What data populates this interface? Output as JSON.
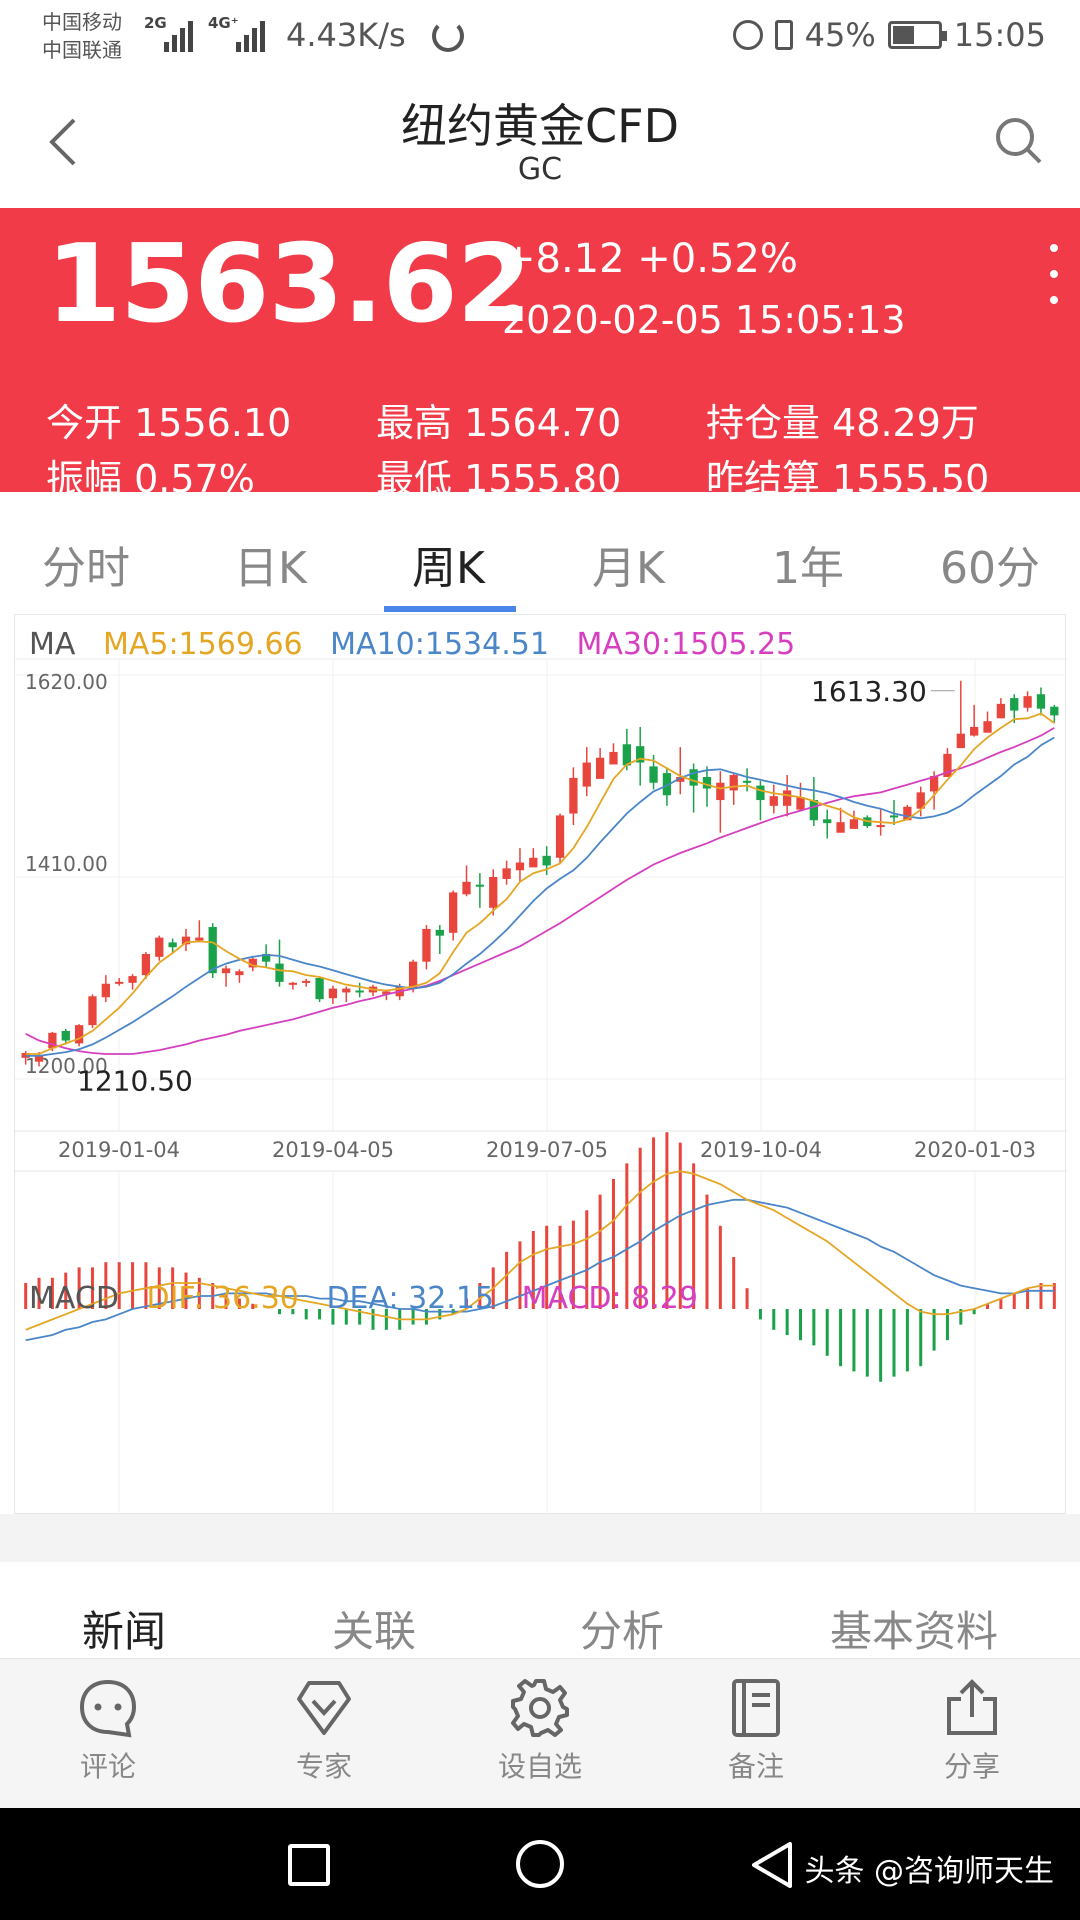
{
  "status_bar": {
    "carrier_1": "中国移动",
    "carrier_2": "中国联通",
    "network_1": "2G",
    "network_2": "4G⁺",
    "speed": "4.43K/s",
    "battery": "45%",
    "time": "15:05"
  },
  "header": {
    "title": "纽约黄金CFD",
    "subtitle": "GC"
  },
  "quote": {
    "price": "1563.62",
    "change": "+8.12 +0.52%",
    "timestamp": "2020-02-05 15:05:13",
    "stats": [
      {
        "label": "今开",
        "value": "1556.10"
      },
      {
        "label": "最高",
        "value": "1564.70"
      },
      {
        "label": "持仓量",
        "value": "48.29万"
      },
      {
        "label": "振幅",
        "value": "0.57%"
      },
      {
        "label": "最低",
        "value": "1555.80"
      },
      {
        "label": "昨结算",
        "value": "1555.50"
      }
    ]
  },
  "period_tabs": [
    {
      "label": "分时",
      "active": false
    },
    {
      "label": "日K",
      "active": false
    },
    {
      "label": "周K",
      "active": true
    },
    {
      "label": "月K",
      "active": false
    },
    {
      "label": "1年",
      "active": false
    },
    {
      "label": "60分",
      "active": false
    }
  ],
  "indicators": {
    "ma_label": "MA",
    "ma5": "MA5:1569.66",
    "ma10": "MA10:1534.51",
    "ma30": "MA30:1505.25",
    "macd_label": "MACD",
    "dif": "DIF: 36.30",
    "dea": "DEA: 32.15",
    "macd": "MACD: 8.29"
  },
  "colors": {
    "up": "#e8453c",
    "down": "#1aa24a",
    "ma5": "#e5a623",
    "ma10": "#4a86c8",
    "ma30": "#d63fbf",
    "accent": "#f23b48"
  },
  "chart_data": {
    "type": "candlestick",
    "y_tick_labels": [
      "1620.00",
      "1410.00",
      "1200.00"
    ],
    "ylim": [
      1200,
      1620
    ],
    "x_tick_labels": [
      "2019-01-04",
      "2019-04-05",
      "2019-07-05",
      "2019-10-04",
      "2020-01-03"
    ],
    "high_label": "1613.30",
    "low_label": "1210.50",
    "candles": [
      [
        1222,
        1227,
        1215,
        1229
      ],
      [
        1218,
        1225,
        1213,
        1228
      ],
      [
        1232,
        1248,
        1229,
        1249
      ],
      [
        1250,
        1240,
        1236,
        1252
      ],
      [
        1237,
        1256,
        1234,
        1257
      ],
      [
        1256,
        1286,
        1253,
        1288
      ],
      [
        1285,
        1299,
        1280,
        1308
      ],
      [
        1300,
        1301,
        1297,
        1305
      ],
      [
        1300,
        1307,
        1293,
        1309
      ],
      [
        1308,
        1330,
        1304,
        1332
      ],
      [
        1327,
        1347,
        1323,
        1349
      ],
      [
        1342,
        1337,
        1330,
        1346
      ],
      [
        1340,
        1348,
        1333,
        1356
      ],
      [
        1344,
        1347,
        1342,
        1365
      ],
      [
        1358,
        1310,
        1305,
        1362
      ],
      [
        1310,
        1315,
        1296,
        1318
      ],
      [
        1308,
        1312,
        1300,
        1314
      ],
      [
        1316,
        1325,
        1312,
        1327
      ],
      [
        1330,
        1322,
        1316,
        1340
      ],
      [
        1320,
        1301,
        1296,
        1345
      ],
      [
        1300,
        1300,
        1293,
        1301
      ],
      [
        1302,
        1302,
        1296,
        1304
      ],
      [
        1305,
        1283,
        1280,
        1306
      ],
      [
        1284,
        1294,
        1278,
        1297
      ],
      [
        1290,
        1294,
        1280,
        1296
      ],
      [
        1292,
        1290,
        1285,
        1300
      ],
      [
        1290,
        1296,
        1286,
        1298
      ],
      [
        1288,
        1291,
        1282,
        1293
      ],
      [
        1286,
        1296,
        1282,
        1299
      ],
      [
        1294,
        1322,
        1290,
        1324
      ],
      [
        1322,
        1356,
        1314,
        1360
      ],
      [
        1355,
        1349,
        1330,
        1360
      ],
      [
        1352,
        1394,
        1344,
        1396
      ],
      [
        1392,
        1405,
        1390,
        1422
      ],
      [
        1402,
        1400,
        1378,
        1414
      ],
      [
        1378,
        1410,
        1370,
        1418
      ],
      [
        1408,
        1419,
        1402,
        1427
      ],
      [
        1417,
        1425,
        1405,
        1440
      ],
      [
        1420,
        1430,
        1424,
        1440
      ],
      [
        1432,
        1422,
        1412,
        1442
      ],
      [
        1430,
        1474,
        1424,
        1476
      ],
      [
        1476,
        1513,
        1464,
        1524
      ],
      [
        1504,
        1529,
        1494,
        1545
      ],
      [
        1512,
        1534,
        1517,
        1544
      ],
      [
        1527,
        1540,
        1532,
        1549
      ],
      [
        1548,
        1526,
        1521,
        1564
      ],
      [
        1546,
        1529,
        1505,
        1566
      ],
      [
        1525,
        1508,
        1501,
        1537
      ],
      [
        1518,
        1495,
        1484,
        1523
      ],
      [
        1509,
        1514,
        1496,
        1545
      ],
      [
        1522,
        1505,
        1477,
        1528
      ],
      [
        1514,
        1502,
        1483,
        1525
      ],
      [
        1490,
        1508,
        1456,
        1520
      ],
      [
        1500,
        1516,
        1485,
        1517
      ],
      [
        1510,
        1508,
        1499,
        1523
      ],
      [
        1505,
        1490,
        1469,
        1510
      ],
      [
        1484,
        1494,
        1476,
        1506
      ],
      [
        1484,
        1500,
        1473,
        1516
      ],
      [
        1480,
        1493,
        1478,
        1508
      ],
      [
        1490,
        1469,
        1463,
        1514
      ],
      [
        1470,
        1466,
        1450,
        1480
      ],
      [
        1456,
        1467,
        1460,
        1482
      ],
      [
        1460,
        1470,
        1466,
        1479
      ],
      [
        1472,
        1463,
        1461,
        1474
      ],
      [
        1462,
        1464,
        1453,
        1480
      ],
      [
        1474,
        1472,
        1464,
        1490
      ],
      [
        1469,
        1483,
        1470,
        1485
      ],
      [
        1481,
        1498,
        1473,
        1504
      ],
      [
        1499,
        1515,
        1480,
        1520
      ],
      [
        1514,
        1538,
        1515,
        1544
      ],
      [
        1544,
        1559,
        1547,
        1614
      ],
      [
        1557,
        1566,
        1556,
        1589
      ],
      [
        1560,
        1572,
        1568,
        1582
      ],
      [
        1575,
        1590,
        1575,
        1596
      ],
      [
        1596,
        1583,
        1570,
        1600
      ],
      [
        1586,
        1598,
        1582,
        1603
      ],
      [
        1600,
        1585,
        1578,
        1607
      ],
      [
        1587,
        1578,
        1570,
        1589
      ]
    ],
    "ma5_values": [
      1226,
      1226,
      1232,
      1237,
      1242,
      1250,
      1262,
      1274,
      1289,
      1306,
      1321,
      1331,
      1342,
      1343,
      1342,
      1333,
      1325,
      1318,
      1316,
      1313,
      1312,
      1308,
      1306,
      1302,
      1298,
      1296,
      1293,
      1292,
      1294,
      1296,
      1300,
      1310,
      1332,
      1352,
      1362,
      1375,
      1387,
      1405,
      1414,
      1418,
      1424,
      1440,
      1462,
      1487,
      1512,
      1527,
      1533,
      1531,
      1523,
      1515,
      1510,
      1506,
      1502,
      1504,
      1505,
      1500,
      1497,
      1495,
      1493,
      1489,
      1484,
      1480,
      1472,
      1468,
      1467,
      1466,
      1470,
      1480,
      1495,
      1511,
      1526,
      1543,
      1555,
      1565,
      1574,
      1575,
      1580,
      1570
    ],
    "ma10_values": [
      1224,
      1224,
      1226,
      1228,
      1231,
      1236,
      1243,
      1251,
      1259,
      1268,
      1277,
      1286,
      1296,
      1305,
      1314,
      1320,
      1324,
      1327,
      1329,
      1328,
      1324,
      1320,
      1317,
      1313,
      1309,
      1305,
      1301,
      1298,
      1296,
      1294,
      1296,
      1300,
      1309,
      1320,
      1330,
      1342,
      1355,
      1370,
      1385,
      1398,
      1408,
      1417,
      1430,
      1446,
      1461,
      1476,
      1488,
      1499,
      1505,
      1513,
      1518,
      1521,
      1522,
      1518,
      1514,
      1511,
      1508,
      1505,
      1502,
      1500,
      1497,
      1493,
      1488,
      1484,
      1481,
      1476,
      1473,
      1471,
      1473,
      1477,
      1484,
      1495,
      1505,
      1515,
      1527,
      1535,
      1547,
      1555
    ],
    "ma30_values": [
      1247,
      1240,
      1236,
      1232,
      1229,
      1227,
      1226,
      1226,
      1226,
      1228,
      1230,
      1233,
      1236,
      1240,
      1243,
      1246,
      1250,
      1253,
      1256,
      1259,
      1262,
      1266,
      1270,
      1274,
      1277,
      1281,
      1284,
      1288,
      1291,
      1294,
      1297,
      1302,
      1308,
      1314,
      1320,
      1326,
      1332,
      1338,
      1346,
      1354,
      1362,
      1371,
      1380,
      1389,
      1398,
      1407,
      1415,
      1423,
      1429,
      1435,
      1440,
      1445,
      1451,
      1456,
      1461,
      1466,
      1471,
      1475,
      1479,
      1483,
      1487,
      1491,
      1494,
      1496,
      1498,
      1502,
      1506,
      1510,
      1514,
      1519,
      1523,
      1528,
      1534,
      1540,
      1545,
      1551,
      1557,
      1565
    ],
    "macd_dif": [
      -8,
      -6,
      -4,
      -2,
      0,
      2,
      4,
      6,
      7,
      8,
      9,
      10,
      10,
      10,
      9,
      8,
      7,
      6,
      5,
      5,
      4,
      3,
      2,
      1,
      0,
      -1,
      -2,
      -3,
      -4,
      -4,
      -4,
      -3,
      -2,
      0,
      4,
      8,
      13,
      18,
      21,
      23,
      24,
      25,
      27,
      30,
      34,
      40,
      45,
      49,
      52,
      53,
      52,
      50,
      48,
      45,
      42,
      40,
      38,
      35,
      32,
      29,
      26,
      22,
      18,
      14,
      10,
      6,
      2,
      -1,
      -2,
      -2,
      -1,
      0,
      2,
      4,
      6,
      8,
      9,
      9
    ],
    "macd_dea": [
      -12,
      -11,
      -10,
      -8,
      -7,
      -5,
      -4,
      -2,
      0,
      1,
      2,
      3,
      4,
      5,
      5,
      6,
      6,
      6,
      6,
      5,
      5,
      5,
      4,
      4,
      3,
      3,
      2,
      1,
      0,
      0,
      -1,
      -1,
      -1,
      -1,
      0,
      1,
      3,
      5,
      7,
      9,
      11,
      13,
      15,
      18,
      20,
      23,
      26,
      30,
      33,
      36,
      38,
      40,
      41,
      42,
      42,
      41,
      40,
      39,
      37,
      35,
      33,
      31,
      29,
      27,
      24,
      22,
      19,
      16,
      13,
      11,
      9,
      8,
      7,
      6,
      6,
      7,
      7,
      7
    ],
    "macd_bar": [
      5,
      6,
      6,
      7,
      8,
      8,
      9,
      9,
      9,
      9,
      8,
      8,
      7,
      6,
      5,
      3,
      2,
      1,
      0,
      -1,
      -1,
      -2,
      -2,
      -3,
      -3,
      -3,
      -4,
      -4,
      -4,
      -3,
      -3,
      -2,
      -1,
      2,
      5,
      8,
      11,
      13,
      15,
      16,
      16,
      17,
      19,
      22,
      25,
      28,
      31,
      33,
      34,
      32,
      28,
      22,
      16,
      10,
      4,
      -2,
      -4,
      -5,
      -6,
      -7,
      -9,
      -11,
      -12,
      -13,
      -14,
      -13,
      -12,
      -11,
      -8,
      -6,
      -3,
      -1,
      1,
      2,
      3,
      4,
      5,
      5
    ]
  },
  "info_tabs": [
    {
      "label": "新闻",
      "active": true
    },
    {
      "label": "关联",
      "active": false
    },
    {
      "label": "分析",
      "active": false
    },
    {
      "label": "基本资料",
      "active": false
    }
  ],
  "toolbar": [
    {
      "label": "评论",
      "icon": "comment-icon"
    },
    {
      "label": "专家",
      "icon": "expert-icon"
    },
    {
      "label": "设自选",
      "icon": "gear-icon"
    },
    {
      "label": "备注",
      "icon": "note-icon"
    },
    {
      "label": "分享",
      "icon": "share-icon"
    }
  ],
  "watermark": "头条 @咨询师天生"
}
